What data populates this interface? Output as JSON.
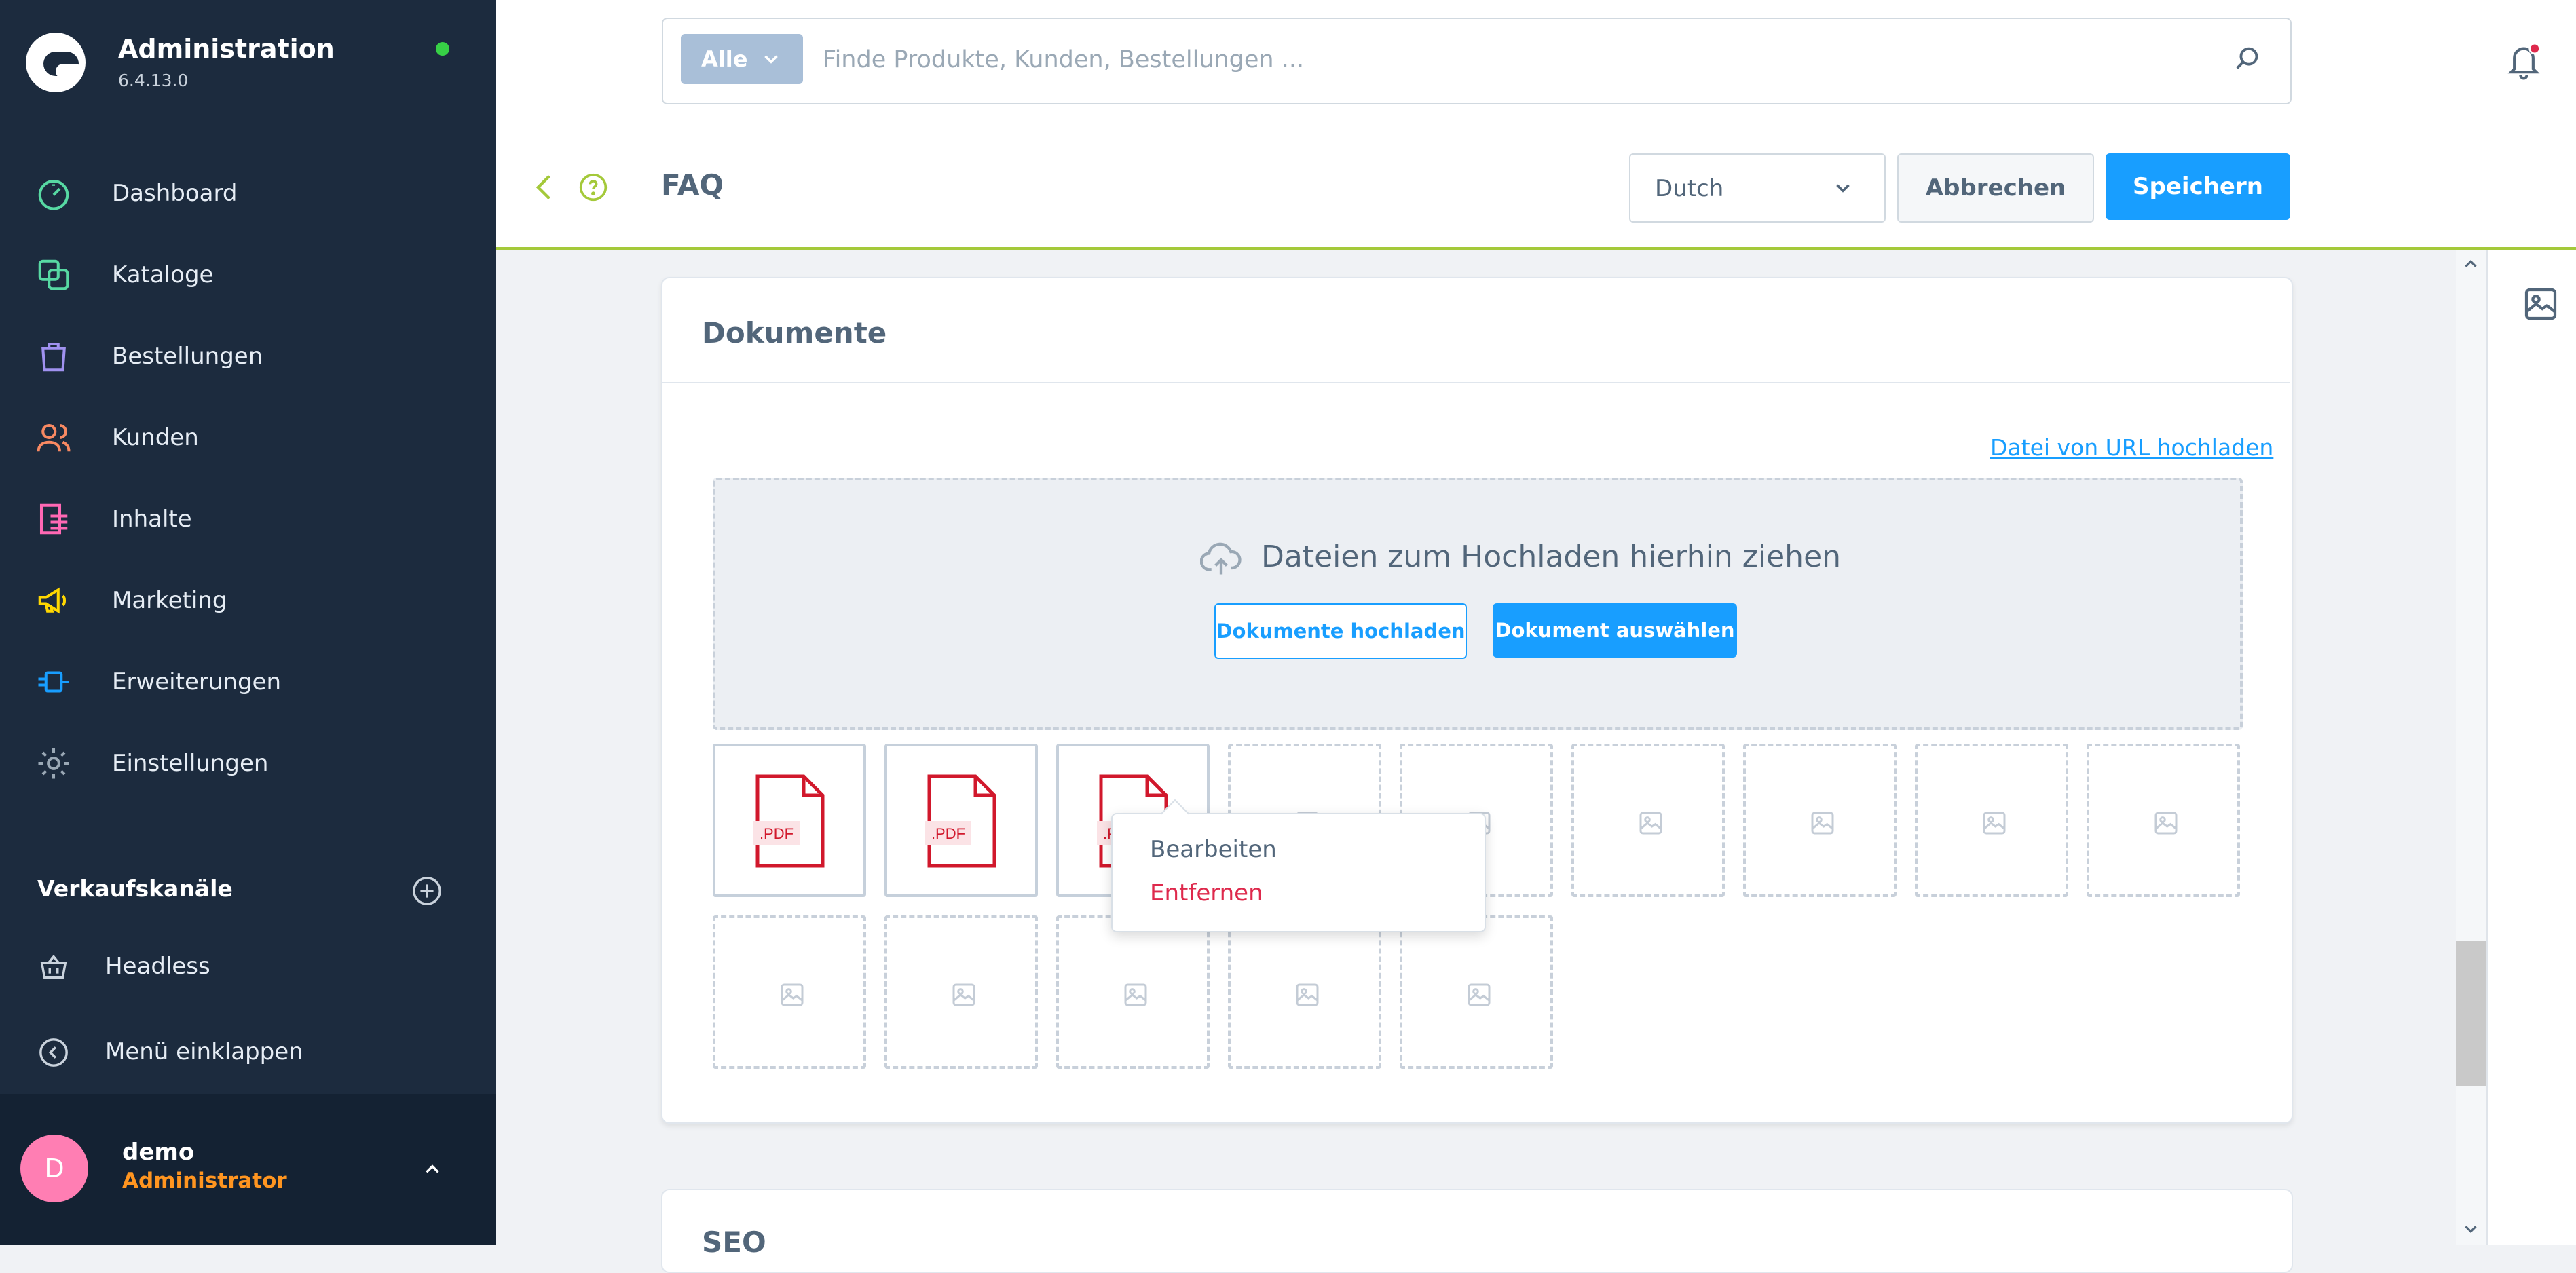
{
  "app": {
    "title": "Administration",
    "version": "6.4.13.0",
    "status_color": "#37d046"
  },
  "sidebar": {
    "items": [
      {
        "label": "Dashboard",
        "icon": "dashboard-gauge-icon",
        "color": "#57d9a3"
      },
      {
        "label": "Kataloge",
        "icon": "catalog-icon",
        "color": "#57d9a3"
      },
      {
        "label": "Bestellungen",
        "icon": "orders-bag-icon",
        "color": "#a092f0"
      },
      {
        "label": "Kunden",
        "icon": "customers-icon",
        "color": "#f88962"
      },
      {
        "label": "Inhalte",
        "icon": "content-icon",
        "color": "#ff68b4"
      },
      {
        "label": "Marketing",
        "icon": "marketing-megaphone-icon",
        "color": "#ffd700"
      },
      {
        "label": "Erweiterungen",
        "icon": "extensions-plug-icon",
        "color": "#189eff"
      },
      {
        "label": "Einstellungen",
        "icon": "settings-gear-icon",
        "color": "#9aa8b5"
      }
    ],
    "sales_channels_title": "Verkaufskanäle",
    "sales_channel": "Headless",
    "collapse_label": "Menü einklappen"
  },
  "user": {
    "initial": "D",
    "name": "demo",
    "role": "Administrator"
  },
  "search": {
    "type_label": "Alle",
    "placeholder": "Finde Produkte, Kunden, Bestellungen ..."
  },
  "header": {
    "title": "FAQ",
    "language": "Dutch",
    "cancel_label": "Abbrechen",
    "save_label": "Speichern"
  },
  "documents": {
    "title": "Dokumente",
    "url_upload_label": "Datei von URL hochladen",
    "drop_text": "Dateien zum Hochladen hierhin ziehen",
    "upload_button": "Dokumente hochladen",
    "select_button": "Dokument auswählen",
    "files": [
      {
        "badge": ".PDF"
      },
      {
        "badge": ".PDF"
      },
      {
        "badge": ".PDF"
      }
    ],
    "empty_slots": 11
  },
  "context_menu": {
    "edit": "Bearbeiten",
    "remove": "Entfernen"
  },
  "seo": {
    "title": "SEO"
  },
  "colors": {
    "sidebar": "#1c2b3e",
    "primary": "#189eff",
    "header_accent": "#a4c93a",
    "danger": "#de294c",
    "role": "#ff9520"
  }
}
